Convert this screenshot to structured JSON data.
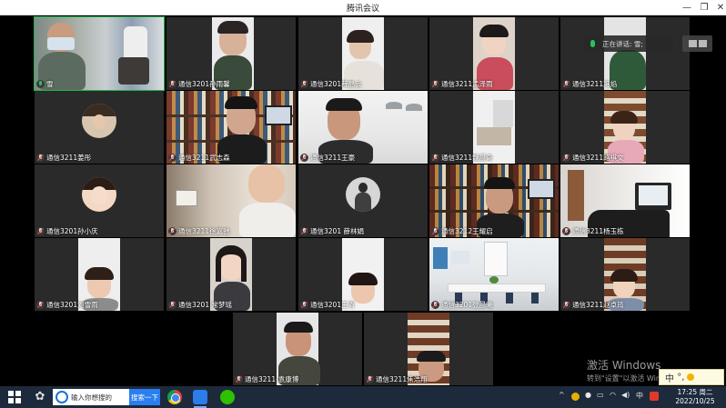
{
  "window": {
    "title": "腾讯会议"
  },
  "speaking": {
    "label": "正在讲话: 雪;"
  },
  "tiles": [
    {
      "name": "雪",
      "mic": "on"
    },
    {
      "name": "通信3201孙雨馨",
      "mic": "off"
    },
    {
      "name": "通信3201薛晶云",
      "mic": "off"
    },
    {
      "name": "通信3211孟泽雨",
      "mic": "off"
    },
    {
      "name": "通信3211冯焰",
      "mic": "off"
    },
    {
      "name": "通信3211姜彤",
      "mic": "off"
    },
    {
      "name": "通信3211武志森",
      "mic": "off"
    },
    {
      "name": "通信3211王豪",
      "mic": "off"
    },
    {
      "name": "通信3211魏晨奇",
      "mic": "off"
    },
    {
      "name": "通信3211路祺文",
      "mic": "off"
    },
    {
      "name": "通信3201孙小庆",
      "mic": "off"
    },
    {
      "name": "通信3211徐嘉驰",
      "mic": "off"
    },
    {
      "name": "通信3201 薛林娟",
      "mic": "off"
    },
    {
      "name": "通信3212王耀启",
      "mic": "off"
    },
    {
      "name": "通信3211杨玉栋",
      "mic": "off"
    },
    {
      "name": "通信3201刘雪雨",
      "mic": "off"
    },
    {
      "name": "通信3201 常梦瑶",
      "mic": "off"
    },
    {
      "name": "通信3201王青",
      "mic": "off"
    },
    {
      "name": "通信3201张晨曦",
      "mic": "off"
    },
    {
      "name": "通信3211赵卓筠",
      "mic": "off"
    },
    {
      "name": "通信3211-袁康博",
      "mic": "off"
    },
    {
      "name": "通信3211焦浩翔",
      "mic": "off"
    }
  ],
  "watermark": {
    "line1": "激活 Windows",
    "line2": "转到\"设置\"以激活 Windows。"
  },
  "ime": {
    "mode": "中",
    "punct": "°,"
  },
  "taskbar": {
    "search_placeholder": "输入你想搜的",
    "search_button": "搜索一下",
    "tray_lang": "中",
    "time": "17:25 周二",
    "date": "2022/10/25"
  },
  "colors": {
    "active_speaker": "#20b64c",
    "muted": "#e84a4a",
    "taskbar": "#1c2a3c"
  }
}
